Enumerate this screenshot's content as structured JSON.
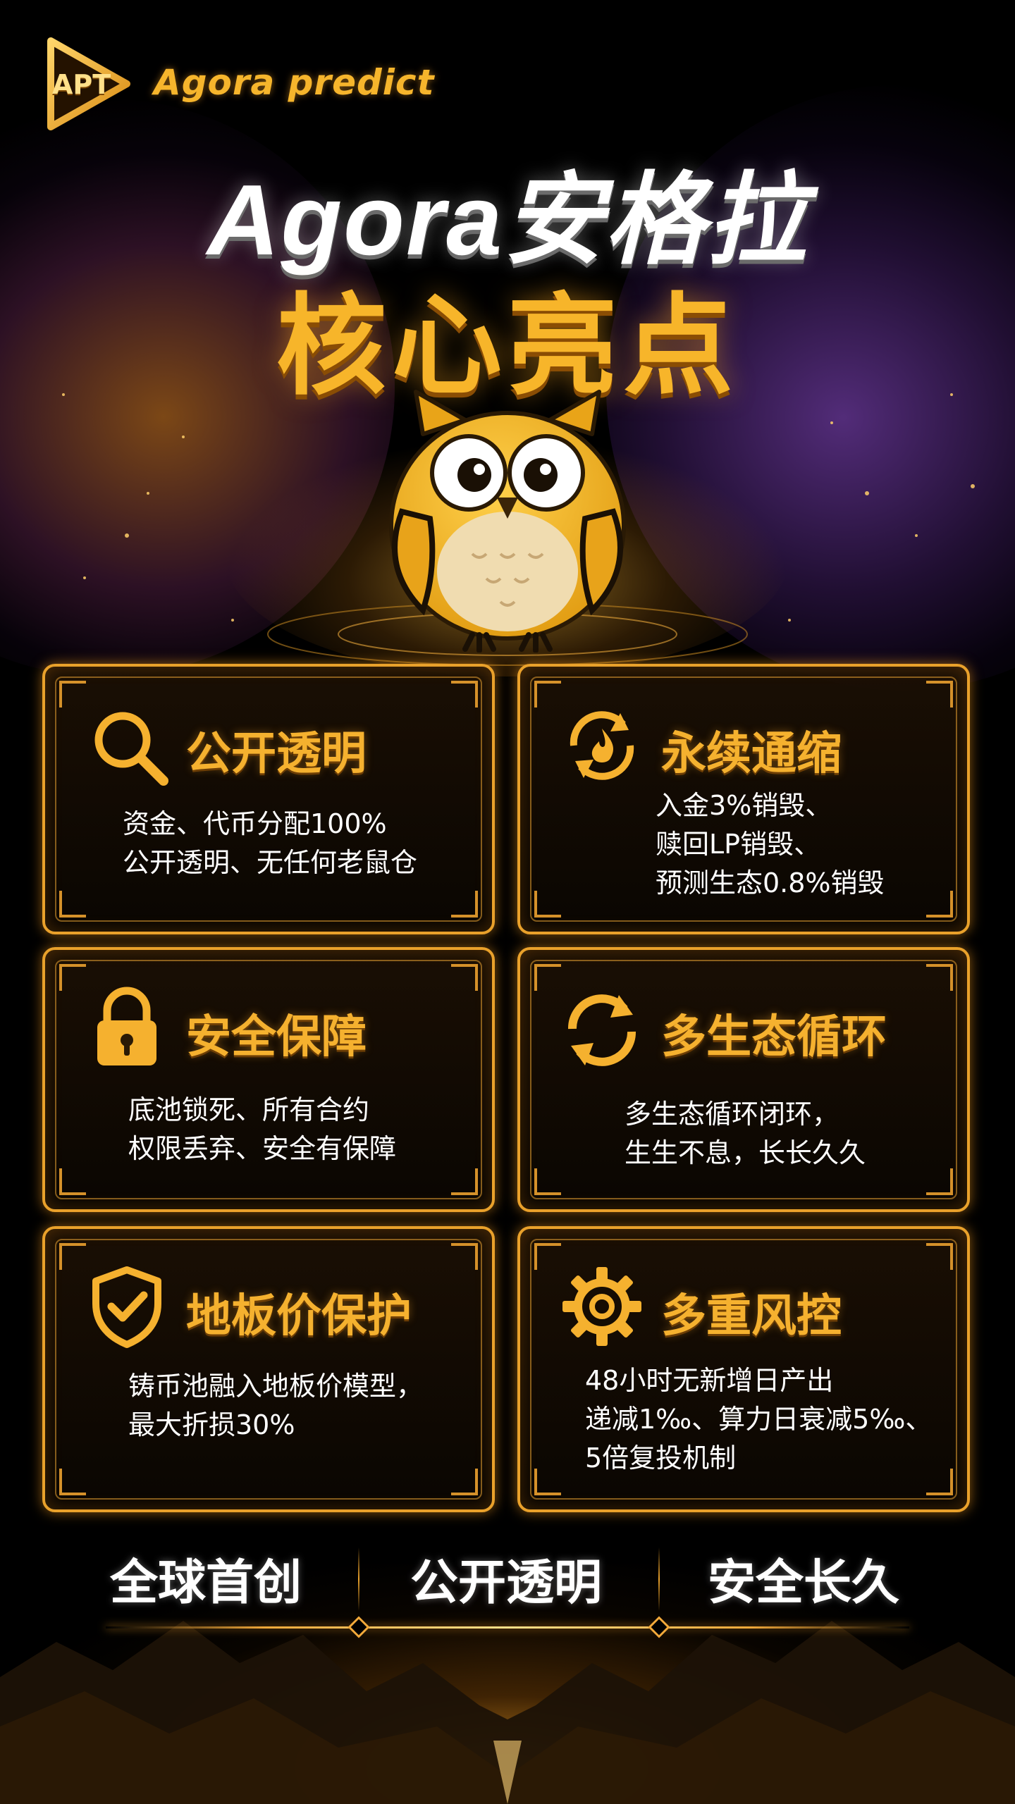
{
  "logo": {
    "badge": "APT",
    "name": "Agora predict"
  },
  "title": {
    "line1": "Agora安格拉",
    "line2": "核心亮点"
  },
  "cards": [
    {
      "title": "公开透明",
      "icon": "magnifier-icon",
      "lines": [
        "资金、代币分配100%",
        "公开透明、无任何老鼠仓"
      ]
    },
    {
      "title": "永续通缩",
      "icon": "fire-cycle-icon",
      "lines": [
        "入金3%销毁、",
        "赎回LP销毁、",
        "预测生态0.8%销毁"
      ]
    },
    {
      "title": "安全保障",
      "icon": "lock-icon",
      "lines": [
        "底池锁死、所有合约",
        "权限丢弃、安全有保障"
      ]
    },
    {
      "title": "多生态循环",
      "icon": "refresh-cycle-icon",
      "lines": [
        "多生态循环闭环，",
        "生生不息，长长久久"
      ]
    },
    {
      "title": "地板价保护",
      "icon": "shield-check-icon",
      "lines": [
        "铸币池融入地板价模型，",
        "最大折损30%"
      ]
    },
    {
      "title": "多重风控",
      "icon": "gear-icon",
      "lines": [
        "48小时无新增日产出",
        "递减1‰、算力日衰减5‰、",
        "5倍复投机制"
      ]
    }
  ],
  "slogans": [
    "全球首创",
    "公开透明",
    "安全长久"
  ],
  "colors": {
    "gold": "#f5b12f",
    "background": "#000000",
    "white": "#ffffff"
  }
}
